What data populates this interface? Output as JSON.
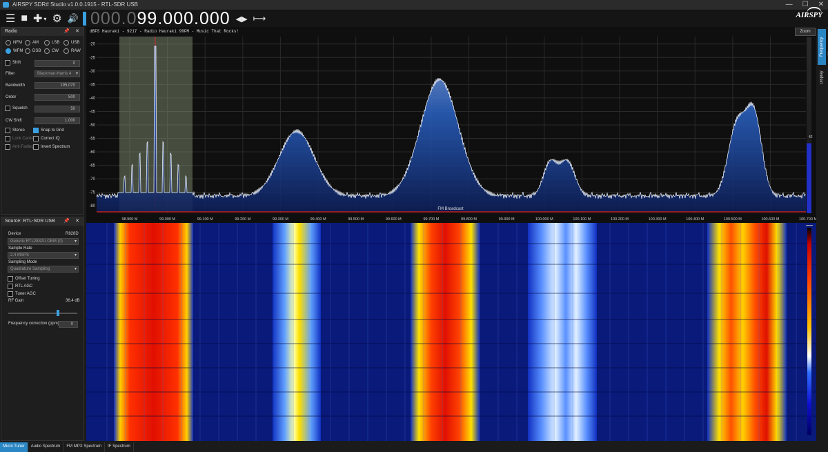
{
  "window": {
    "title": "AIRSPY SDR# Studio v1.0.0.1915 - RTL-SDR USB",
    "minimize": "—",
    "maximize": "☐",
    "close": "✕"
  },
  "toolbar": {
    "menu_icon": "☰",
    "stop_icon": "■",
    "add_icon": "✚",
    "add_dropdown": "▾",
    "settings_icon": "⚙",
    "volume_icon": "🔊",
    "freq_dim": "000.0",
    "freq_main": "99.000.000",
    "tune_arrows": "◀▶",
    "span_icon": "⟼"
  },
  "brand": "AIRSPY",
  "radio_panel": {
    "title": "Radio",
    "pin": "📌",
    "close": "✕",
    "modes": [
      {
        "label": "NFM",
        "on": false
      },
      {
        "label": "AM",
        "on": false
      },
      {
        "label": "LSB",
        "on": false
      },
      {
        "label": "USB",
        "on": false
      },
      {
        "label": "WFM",
        "on": true
      },
      {
        "label": "DSB",
        "on": false
      },
      {
        "label": "CW",
        "on": false
      },
      {
        "label": "RAW",
        "on": false
      }
    ],
    "shift_label": "Shift",
    "shift_value": "0",
    "filter_label": "Filter",
    "filter_value": "Blackman-Harris 4",
    "bandwidth_label": "Bandwidth",
    "bandwidth_value": "195,070",
    "order_label": "Order",
    "order_value": "500",
    "squelch_label": "Squelch",
    "squelch_value": "50",
    "cwshift_label": "CW Shift",
    "cwshift_value": "1,000",
    "options": [
      {
        "label": "Stereo",
        "on": false,
        "dim": false
      },
      {
        "label": "Snap to Grid",
        "on": true,
        "dim": false
      },
      {
        "label": "Lock Carrier",
        "on": false,
        "dim": true
      },
      {
        "label": "Correct IQ",
        "on": false,
        "dim": false
      },
      {
        "label": "Anti-Fading",
        "on": false,
        "dim": true
      },
      {
        "label": "Invert Spectrum",
        "on": false,
        "dim": false
      }
    ]
  },
  "source_panel": {
    "title": "Source: RTL-SDR USB",
    "pin": "📌",
    "close": "✕",
    "device_label": "Device",
    "device_tuner": "R828D",
    "device_value": "Generic RTL2832U OEM (0)",
    "sample_rate_label": "Sample Rate",
    "sample_rate_value": "2.4 MSPS",
    "sampling_mode_label": "Sampling Mode",
    "sampling_mode_value": "Quadrature Sampling",
    "offset_tuning": "Offset Tuning",
    "rtl_agc": "RTL AGC",
    "tuner_agc": "Tuner AGC",
    "rf_gain_label": "RF Gain",
    "rf_gain_value": "36.4 dB",
    "rf_gain_level": 0.72,
    "freq_corr_label": "Frequency correction (ppm)",
    "freq_corr_value": "0"
  },
  "spectrum": {
    "info": "dBFS  Hauraki  - 9217 - Radio Hauraki 99FM - Music That Rocks!",
    "zoom": "Zoom",
    "band_label": "FM Broadcast",
    "gain_value": "42",
    "y_ticks": [
      "-20",
      "-25",
      "-30",
      "-35",
      "-40",
      "-45",
      "-50",
      "-55",
      "-60",
      "-65",
      "-70",
      "-75",
      "-80"
    ],
    "x_ticks": [
      "98.900 M",
      "99.000 M",
      "99.100 M",
      "99.200 M",
      "99.300 M",
      "99.400 M",
      "99.500 M",
      "99.600 M",
      "99.700 M",
      "99.800 M",
      "99.900 M",
      "100.000 M",
      "100.100 M",
      "100.200 M",
      "100.300 M",
      "100.400 M",
      "100.500 M",
      "100.600 M",
      "100.700 M"
    ]
  },
  "right_tabs": {
    "frequency_manager": "Frequency Manager",
    "display": "Display"
  },
  "bottom_tabs": [
    "Micro Tuner",
    "Audio Spectrum",
    "FM MPX Spectrum",
    "IF Spectrum"
  ],
  "colors": {
    "accent": "#2b86c4",
    "spectrum_fill": "#1f4fa8",
    "waterfall_bg": "#0a1a7a",
    "band_line": "#c02020"
  }
}
